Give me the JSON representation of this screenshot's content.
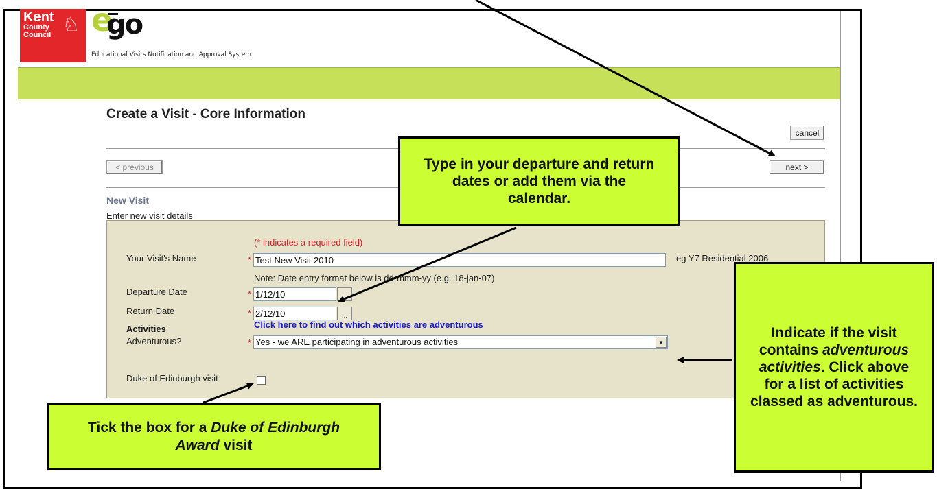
{
  "header": {
    "council_line1": "Kent",
    "council_line2": "County",
    "council_line3": "Council",
    "logo_e": "e",
    "logo_go": "go",
    "subtitle": "Educational Visits Notification and Approval System"
  },
  "page": {
    "title": "Create a Visit - Core Information",
    "cancel_label": "cancel",
    "previous_label": "< previous",
    "next_label": "next >",
    "section_title": "New Visit",
    "section_subtitle": "Enter new visit details"
  },
  "form": {
    "required_note": "(* indicates a required field)",
    "required_mark": "*",
    "visit_name_label": "Your Visit's Name",
    "visit_name_value": "Test New Visit 2010",
    "visit_name_example": "eg Y7 Residential 2006",
    "date_note": "Note: Date entry format below is dd-mmm-yy (e.g. 18-jan-07)",
    "departure_label": "Departure Date",
    "departure_value": "1/12/10",
    "return_label": "Return Date",
    "return_value": "2/12/10",
    "calendar_button": "...",
    "activities_label": "Activities",
    "adventurous_link": "Click here to find out which activities are adventurous",
    "adventurous_label": "Adventurous?",
    "adventurous_value": "Yes - we ARE participating in adventurous activities",
    "duke_label": "Duke of Edinburgh visit",
    "duke_checked": false
  },
  "callouts": {
    "dates": "Type in your departure and return dates or add them via the calendar.",
    "duke_part1": "Tick the box for a ",
    "duke_italic": "Duke of Edinburgh Award",
    "duke_part2": " visit",
    "adv_part1": "Indicate if the visit contains ",
    "adv_italic": "adventurous activities",
    "adv_part2": ". Click above for a list of activities classed as adventurous."
  },
  "colors": {
    "green_band": "#c7e05a",
    "callout_bg": "#ccff33",
    "form_bg": "#e7e3cb",
    "required_red": "#d8242a",
    "link_blue": "#1a1ad0",
    "kent_red": "#e3262a"
  }
}
